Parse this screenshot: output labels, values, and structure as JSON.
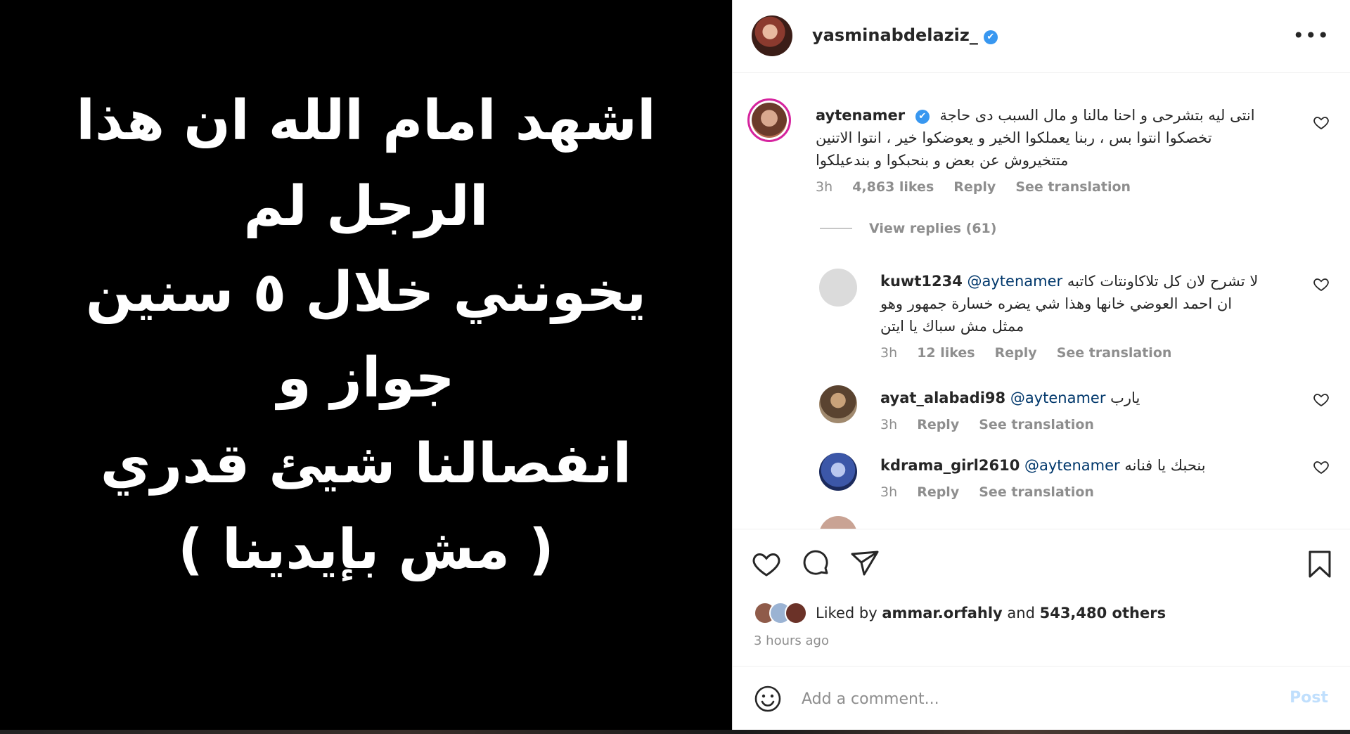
{
  "post_image": {
    "lines": [
      "اشهد امام الله ان هذا الرجل لم",
      "يخونني خلال ٥ سنين جواز و",
      "انفصالنا شيئ قدري",
      "( مش بإيدينا )"
    ]
  },
  "header": {
    "username": "yasminabdelaziz_",
    "verified_icon": "✔",
    "more_icon": "•••"
  },
  "comments": [
    {
      "username": "aytenamer",
      "verified": "✔",
      "text_lines": [
        "انتى ليه بتشرحى و احنا مالنا و مال السبب دى حاجة",
        "تخصكوا انتوا بس ، ربنا يعملكوا الخير و يعوضكوا خير ، انتوا الاتنين",
        "متتخيروش عن بعض و بنحبكوا و بندعيلكوا"
      ],
      "time": "3h",
      "likes": "4,863 likes",
      "reply": "Reply",
      "translate": "See translation"
    },
    {
      "username": "kuwt1234",
      "mention": "@aytenamer",
      "text_lines": [
        "لا تشرح لان كل تلاكاونتات كاتبه",
        "ان احمد العوضي خانها وهذا شي يضره خسارة جمهور وهو",
        "ممثل مش سباك يا ايتن"
      ],
      "time": "3h",
      "likes": "12 likes",
      "reply": "Reply",
      "translate": "See translation"
    },
    {
      "username": "ayat_alabadi98",
      "mention": "@aytenamer",
      "text": "يارب",
      "time": "3h",
      "reply": "Reply",
      "translate": "See translation"
    },
    {
      "username": "kdrama_girl2610",
      "mention": "@aytenamer",
      "text": "بنحبك يا فنانه",
      "time": "3h",
      "reply": "Reply",
      "translate": "See translation"
    }
  ],
  "view_replies": "View replies (61)",
  "likes": {
    "prefix": "Liked by",
    "user": "ammar.orfahly",
    "and": "and",
    "others": "543,480 others"
  },
  "time_ago": "3 hours ago",
  "add_comment": {
    "placeholder": "Add a comment...",
    "post_label": "Post"
  },
  "colors": {
    "accent": "#3897f0",
    "mention": "#00376b",
    "muted": "#8e8e8e",
    "post_disabled": "#c0dffd"
  },
  "icons": [
    "heart-icon",
    "comment-icon",
    "share-icon",
    "bookmark-icon",
    "emoji-icon",
    "more-icon",
    "verified-icon"
  ]
}
